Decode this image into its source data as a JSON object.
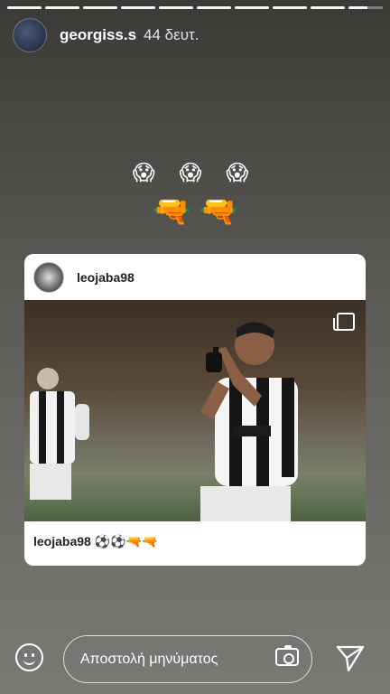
{
  "story": {
    "username": "georgiss.s",
    "time": "44 δευτ.",
    "segments": 10
  },
  "stickers": {
    "scream_emojis": [
      "😱",
      "😱",
      "😱"
    ],
    "gun_emojis": [
      "🔫",
      "🔫"
    ]
  },
  "shared_post": {
    "username": "leojaba98",
    "caption_user": "leojaba98",
    "caption_emojis": "⚽⚽🔫🔫"
  },
  "reply": {
    "placeholder": "Αποστολή μηνύματος"
  },
  "colors": {
    "gun_green": "#34c759"
  }
}
